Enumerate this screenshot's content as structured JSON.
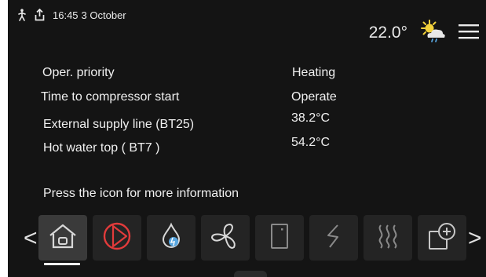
{
  "status_bar": {
    "time": "16:45",
    "date": "3  October",
    "person_icon": "person-walking-icon",
    "upload_icon": "upload-icon"
  },
  "header": {
    "outdoor_temp": "22.0°",
    "weather_icon": "partly-cloudy-rain-icon",
    "menu_icon": "hamburger-menu-icon"
  },
  "info": {
    "rows": [
      {
        "label": "Oper. priority",
        "value": "Heating"
      },
      {
        "label": "Time to compressor start",
        "value": "Operate"
      },
      {
        "label": "External supply line   (BT25)",
        "value": "38.2°C"
      },
      {
        "label": "Hot water top ( BT7 )",
        "value": "54.2°C"
      }
    ],
    "hint": "Press the icon for more information"
  },
  "icon_bar": {
    "prev_label": "<",
    "next_label": ">",
    "tiles": [
      {
        "icon": "home-icon",
        "active": true
      },
      {
        "icon": "compressor-icon",
        "accent": "#e23b3b"
      },
      {
        "icon": "water-drop-icon"
      },
      {
        "icon": "fan-icon"
      },
      {
        "icon": "tank-icon"
      },
      {
        "icon": "electric-heater-icon"
      },
      {
        "icon": "heating-waves-icon"
      },
      {
        "icon": "add-accessory-icon"
      }
    ]
  },
  "colors": {
    "background": "#141414",
    "tile": "#242424",
    "tile_active": "#3a3a3a",
    "accent_red": "#e23b3b",
    "sun": "#f2d13b",
    "drop_blue": "#58a6e0"
  }
}
